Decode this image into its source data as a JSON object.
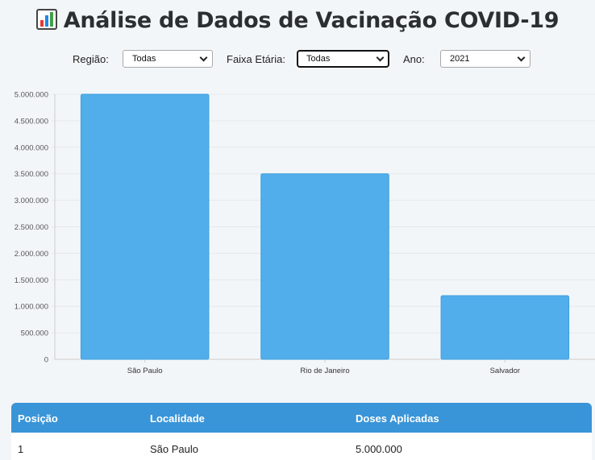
{
  "header": {
    "title": "Análise de Dados de Vacinação COVID-19",
    "icon": "bar-chart-icon"
  },
  "filters": {
    "region_label": "Região:",
    "region_value": "Todas",
    "age_label": "Faixa Etária:",
    "age_value": "Todas",
    "year_label": "Ano:",
    "year_value": "2021"
  },
  "colors": {
    "bar": "#52aeea",
    "table_header": "#3a95d8",
    "grid": "#e6e9ec"
  },
  "chart_data": {
    "type": "bar",
    "title": "",
    "xlabel": "",
    "ylabel": "",
    "categories": [
      "São Paulo",
      "Rio de Janeiro",
      "Salvador"
    ],
    "values": [
      5000000,
      3500000,
      1200000
    ],
    "ylim": [
      0,
      5000000
    ],
    "yticks": [
      0,
      500000,
      1000000,
      1500000,
      2000000,
      2500000,
      3000000,
      3500000,
      4000000,
      4500000,
      5000000
    ],
    "ytick_labels": [
      "0",
      "500.000",
      "1.000.000",
      "1.500.000",
      "2.000.000",
      "2.500.000",
      "3.000.000",
      "3.500.000",
      "4.000.000",
      "4.500.000",
      "5.000.000"
    ],
    "grid": true,
    "legend": "none"
  },
  "table": {
    "headers": [
      "Posição",
      "Localidade",
      "Doses Aplicadas"
    ],
    "rows": [
      [
        "1",
        "São Paulo",
        "5.000.000"
      ]
    ]
  }
}
